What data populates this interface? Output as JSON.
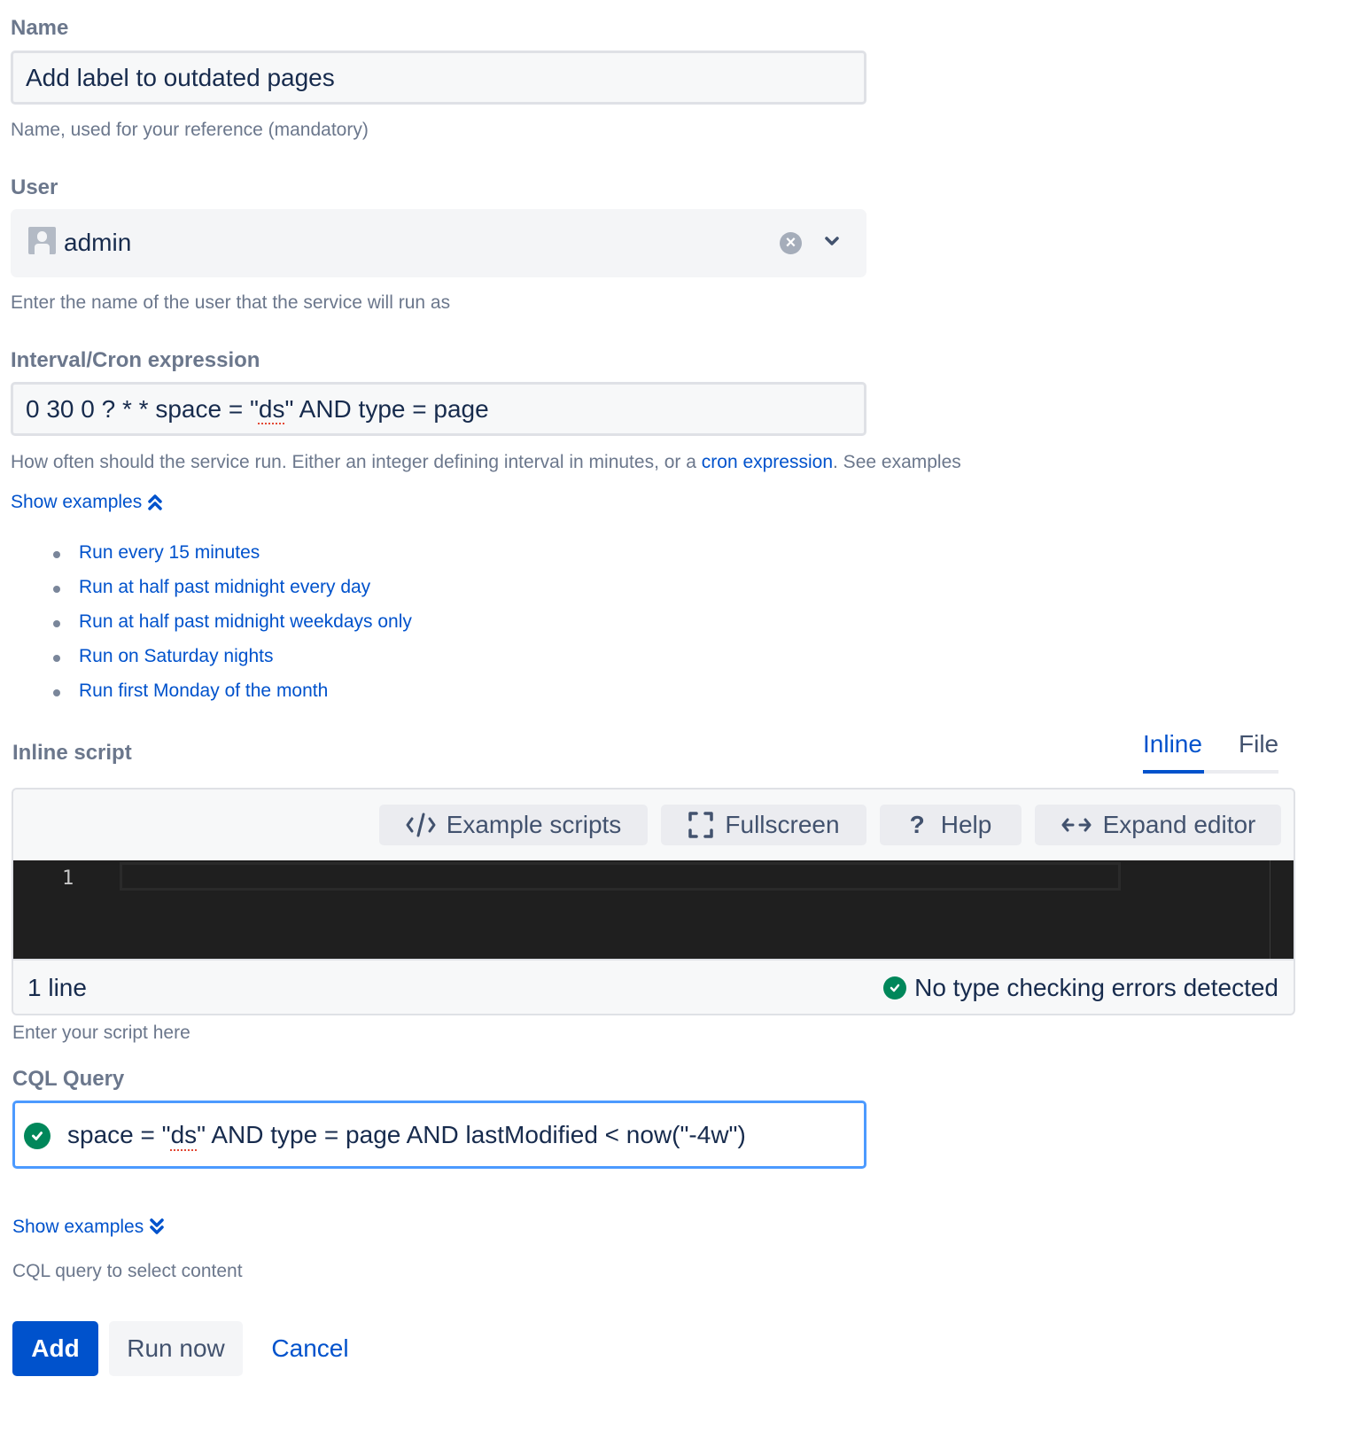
{
  "name": {
    "label": "Name",
    "value": "Add label to outdated pages",
    "help": "Name, used for your reference (mandatory)"
  },
  "user": {
    "label": "User",
    "value": "admin",
    "help": "Enter the name of the user that the service will run as",
    "clear_icon": "clear-icon",
    "chevron_icon": "chevron-down-icon"
  },
  "cron": {
    "label": "Interval/Cron expression",
    "value_prefix": "0 30 0 ? * * space = \"",
    "value_squiggle": "ds",
    "value_suffix": "\" AND type = page",
    "help_before": "How often should the service run. Either an integer defining interval in minutes, or a ",
    "help_link": "cron expression",
    "help_after": ". See examples",
    "toggle_label": "Show examples",
    "examples": [
      "Run every 15 minutes",
      "Run at half past midnight every day",
      "Run at half past midnight weekdays only",
      "Run on Saturday nights",
      "Run first Monday of the month"
    ]
  },
  "script": {
    "label": "Inline script",
    "tabs": [
      {
        "label": "Inline",
        "active": true
      },
      {
        "label": "File",
        "active": false
      }
    ],
    "toolbar": {
      "examples": "Example scripts",
      "fullscreen": "Fullscreen",
      "help": "Help",
      "expand": "Expand editor"
    },
    "gutter_line": "1",
    "line_count": "1 line",
    "type_status": "No type checking errors detected",
    "help": "Enter your script here"
  },
  "cql": {
    "label": "CQL Query",
    "value_prefix": "space = \"",
    "value_squiggle": "ds",
    "value_suffix": "\" AND type = page AND lastModified < now(\"-4w\")",
    "toggle_label": "Show examples",
    "help": "CQL query to select content"
  },
  "actions": {
    "add": "Add",
    "run_now": "Run now",
    "cancel": "Cancel"
  },
  "colors": {
    "primary": "#0052cc",
    "success": "#00875a",
    "focus_border": "#4c9aff",
    "editor_bg": "#1f1f1f"
  }
}
